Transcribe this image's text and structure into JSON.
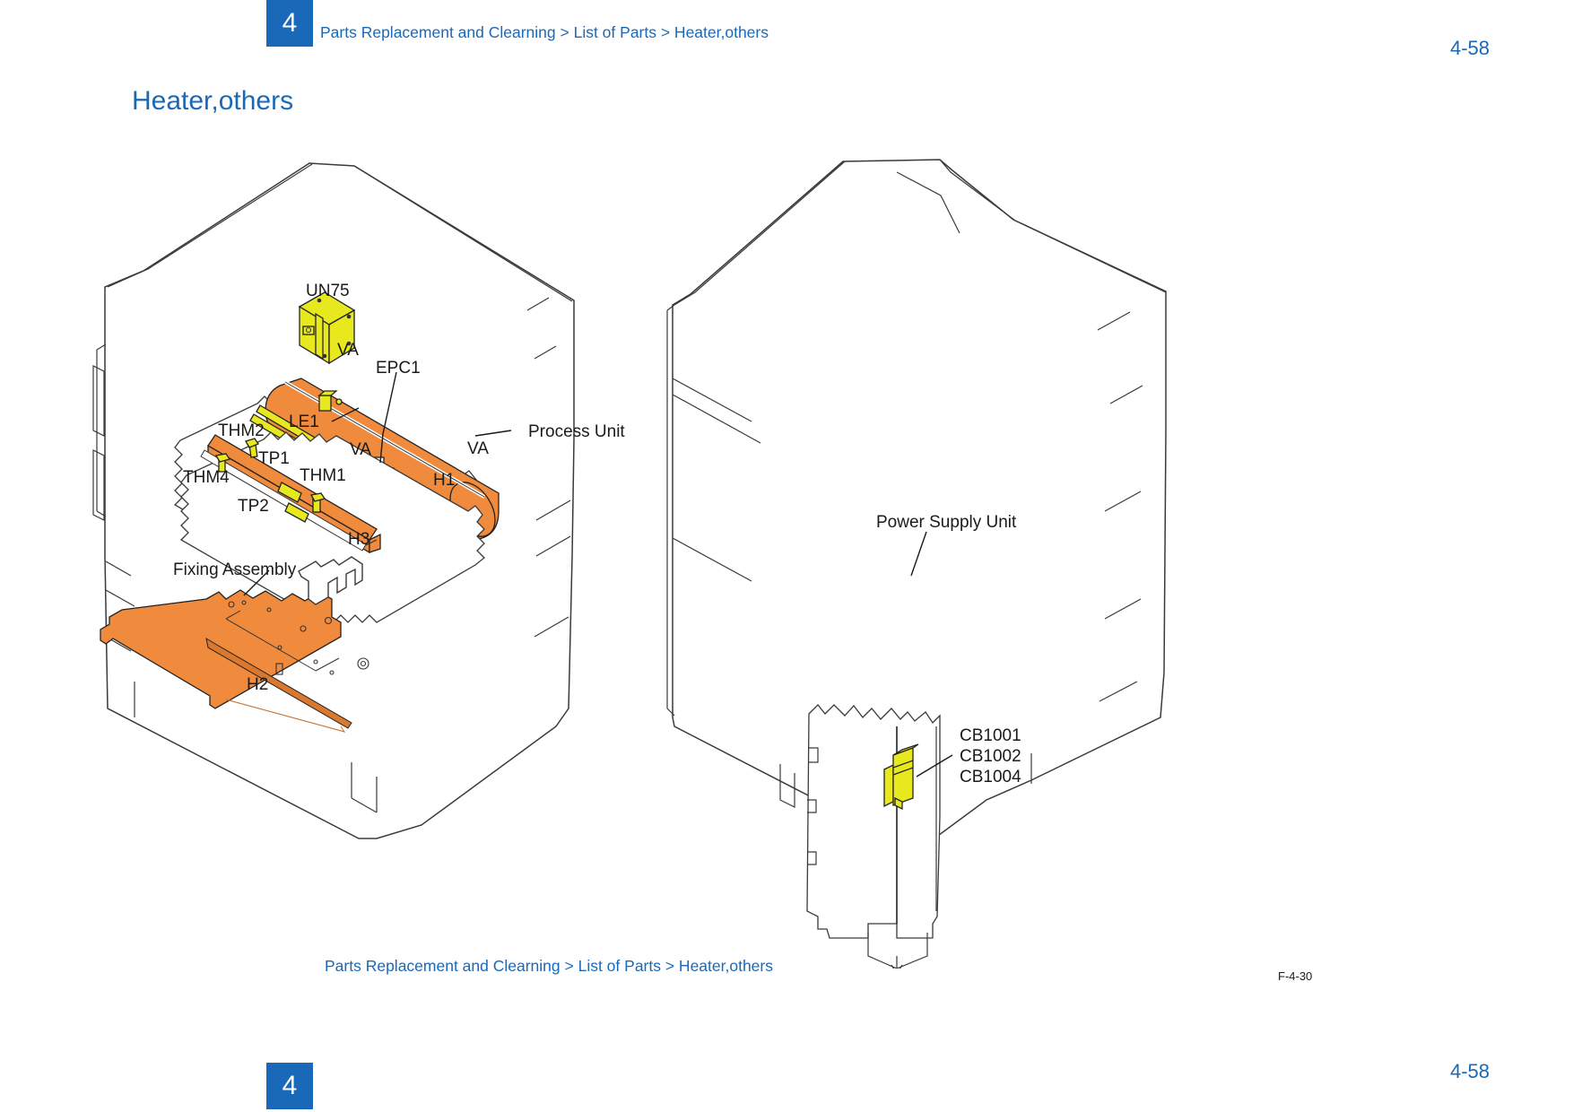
{
  "header": {
    "chapter_number": "4",
    "breadcrumb": "Parts Replacement and Clearning > List of Parts > Heater,others",
    "page_number": "4-58"
  },
  "footer": {
    "chapter_number": "4",
    "breadcrumb": "Parts Replacement and Clearning > List of Parts > Heater,others",
    "page_number": "4-58"
  },
  "page_title": "Heater,others",
  "figure": {
    "caption": "F-4-30",
    "colors": {
      "accent_blue": "#1a69b8",
      "part_orange": "#F08A3C",
      "part_yellow": "#E8E81E",
      "line_black": "#1a1a1a"
    },
    "left_view": {
      "name": "fixing-assembly-exploded-view",
      "callouts": [
        {
          "id": "un75",
          "label": "UN75"
        },
        {
          "id": "va-top",
          "label": "VA"
        },
        {
          "id": "epc1",
          "label": "EPC1"
        },
        {
          "id": "le1",
          "label": "LE1"
        },
        {
          "id": "va-mid",
          "label": "VA"
        },
        {
          "id": "va-right",
          "label": "VA"
        },
        {
          "id": "process-unit",
          "label": "Process Unit"
        },
        {
          "id": "h1",
          "label": "H1"
        },
        {
          "id": "thm2",
          "label": "THM2"
        },
        {
          "id": "tp1",
          "label": "TP1"
        },
        {
          "id": "thm4",
          "label": "THM4"
        },
        {
          "id": "thm1",
          "label": "THM1"
        },
        {
          "id": "tp2",
          "label": "TP2"
        },
        {
          "id": "h3",
          "label": "H3"
        },
        {
          "id": "fixing-assembly",
          "label": "Fixing Assembly"
        },
        {
          "id": "h2",
          "label": "H2"
        }
      ]
    },
    "right_view": {
      "name": "power-supply-unit-view",
      "callouts": [
        {
          "id": "power-supply-unit",
          "label": "Power Supply Unit"
        },
        {
          "id": "cb1001",
          "label": "CB1001"
        },
        {
          "id": "cb1002",
          "label": "CB1002"
        },
        {
          "id": "cb1004",
          "label": "CB1004"
        }
      ]
    }
  }
}
